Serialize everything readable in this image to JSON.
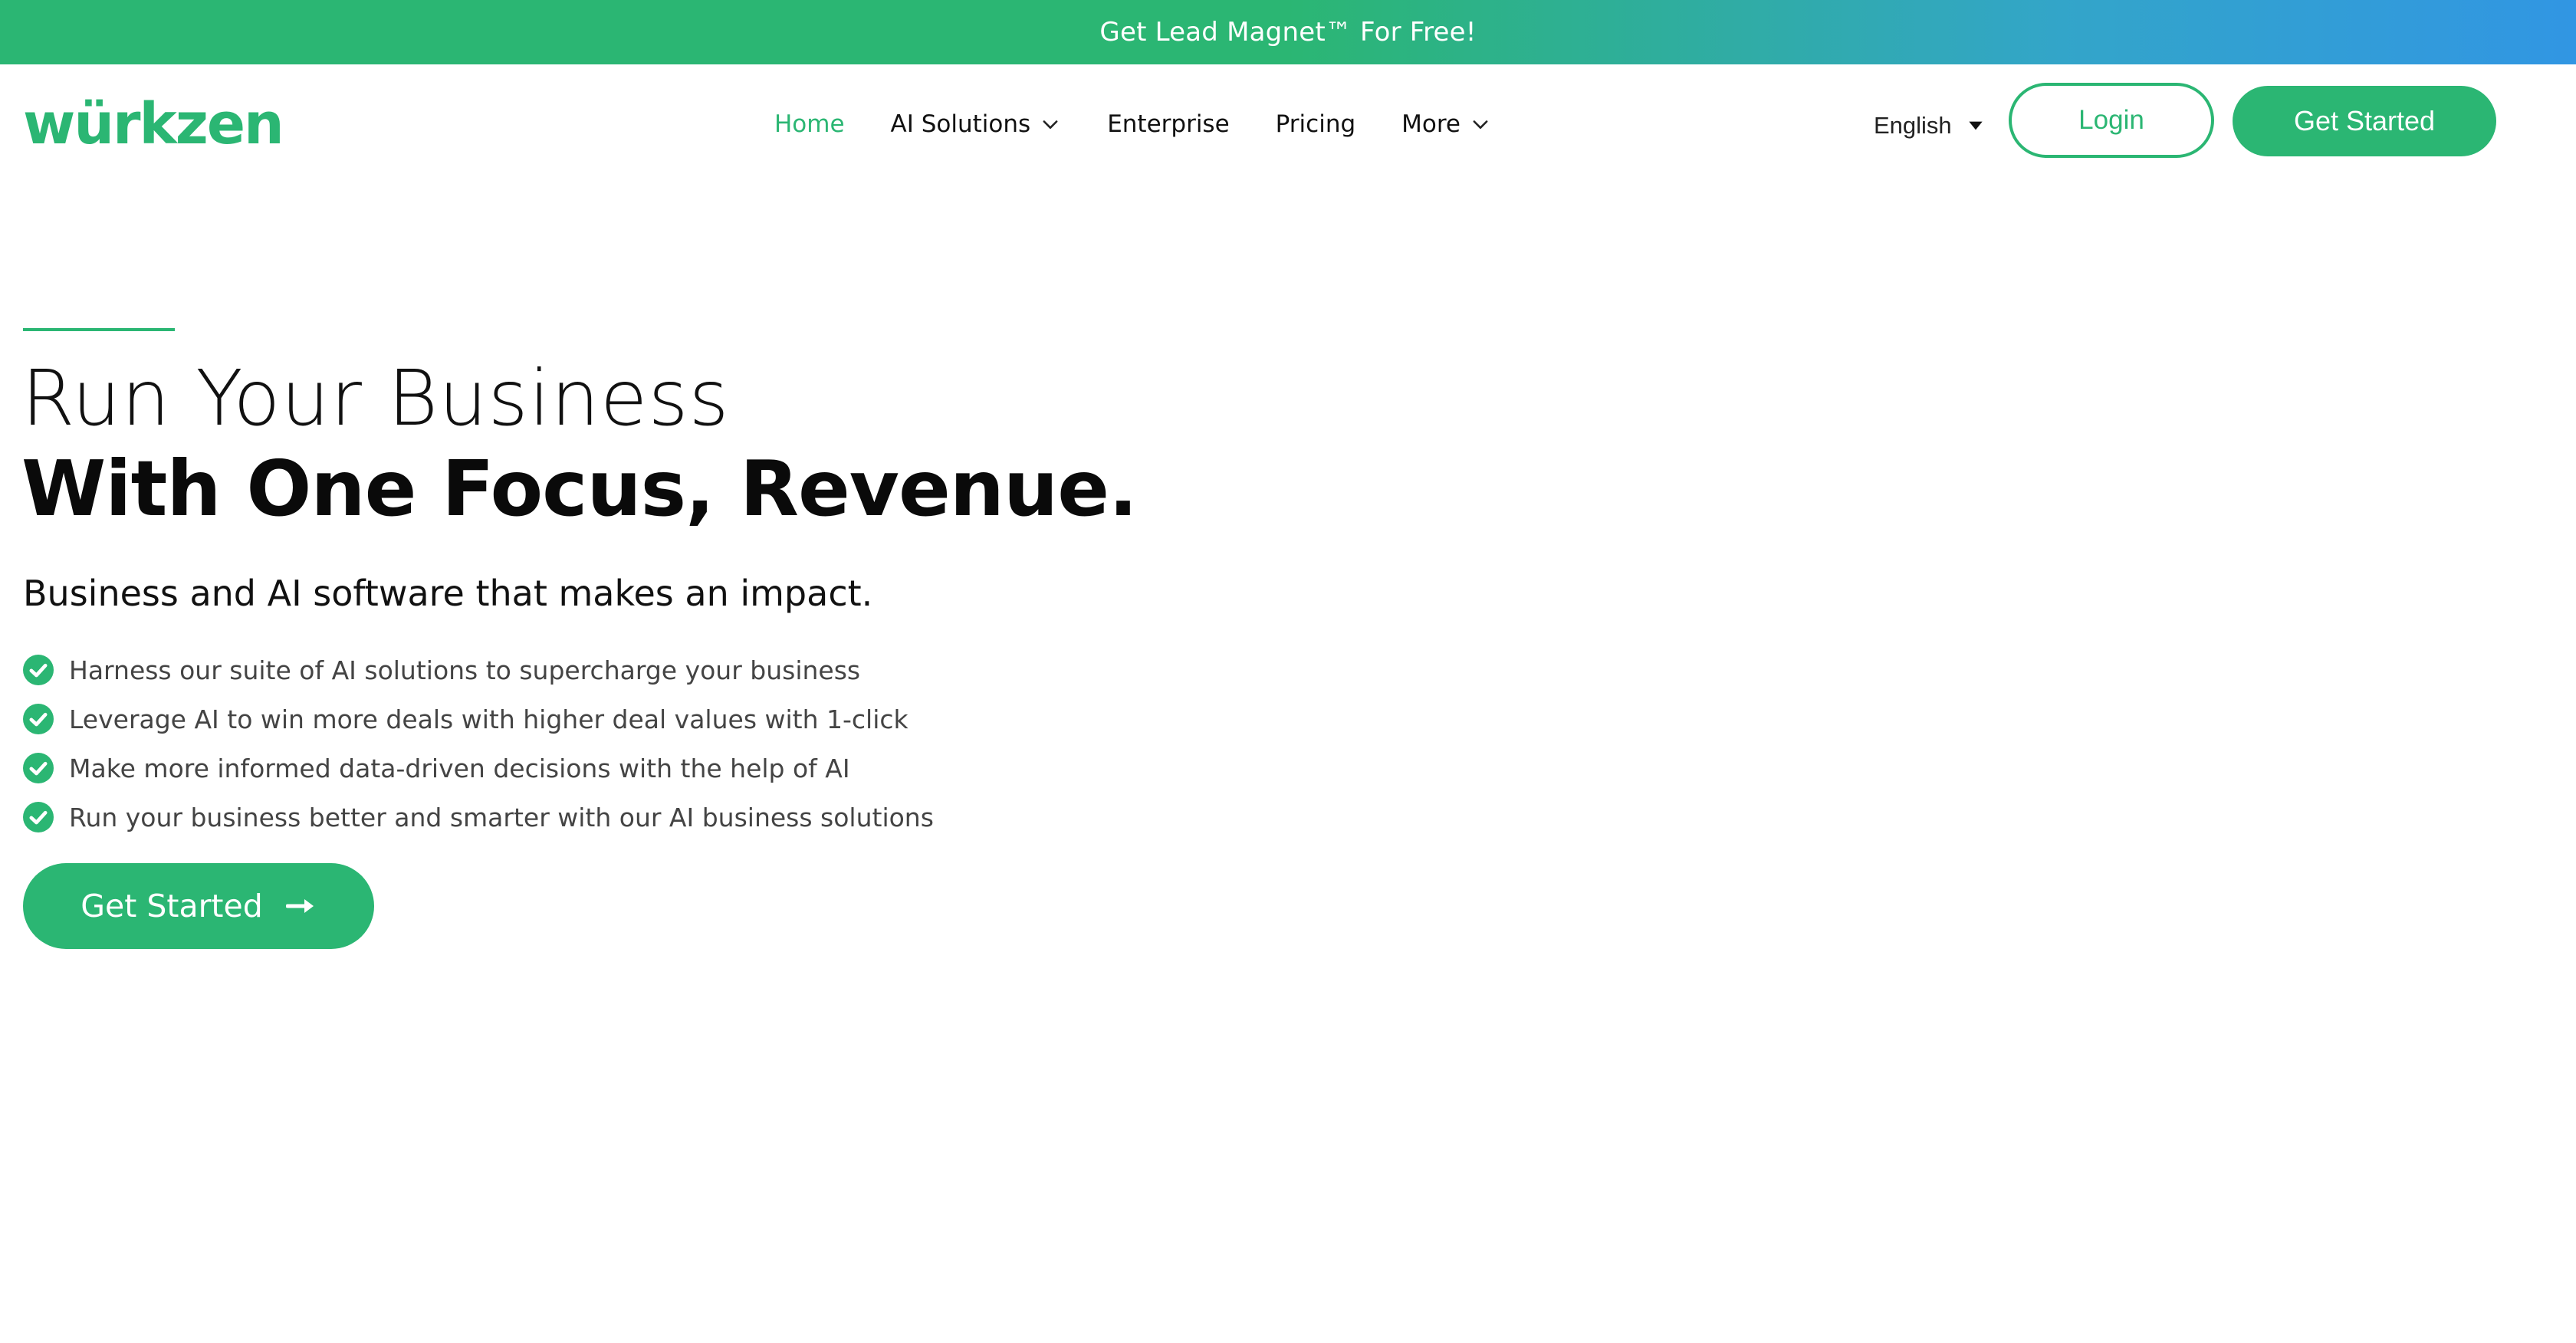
{
  "promo": {
    "text": "Get Lead Magnet™ For Free!"
  },
  "brand": {
    "logo_text": "würkzen",
    "accent": "#2bb673"
  },
  "nav": {
    "items": [
      {
        "label": "Home",
        "active": true,
        "dropdown": false
      },
      {
        "label": "AI Solutions",
        "active": false,
        "dropdown": true
      },
      {
        "label": "Enterprise",
        "active": false,
        "dropdown": false
      },
      {
        "label": "Pricing",
        "active": false,
        "dropdown": false
      },
      {
        "label": "More",
        "active": false,
        "dropdown": true
      }
    ]
  },
  "language": {
    "selected": "English",
    "icon": "caret-down-icon"
  },
  "actions": {
    "login": "Login",
    "get_started": "Get Started"
  },
  "hero": {
    "headline_1": "Run Your Business",
    "headline_2": "With One Focus, Revenue.",
    "subtitle": "Business and AI software that makes an impact.",
    "bullets": [
      "Harness our suite of AI solutions to supercharge your business",
      "Leverage AI to win more deals with higher deal values with 1-click",
      "Make more informed data-driven decisions with the help of AI",
      "Run your business better and smarter with our AI business solutions"
    ],
    "cta": "Get Started",
    "cta_icon": "arrow-right-icon",
    "bullet_icon": "check-circle-icon"
  }
}
